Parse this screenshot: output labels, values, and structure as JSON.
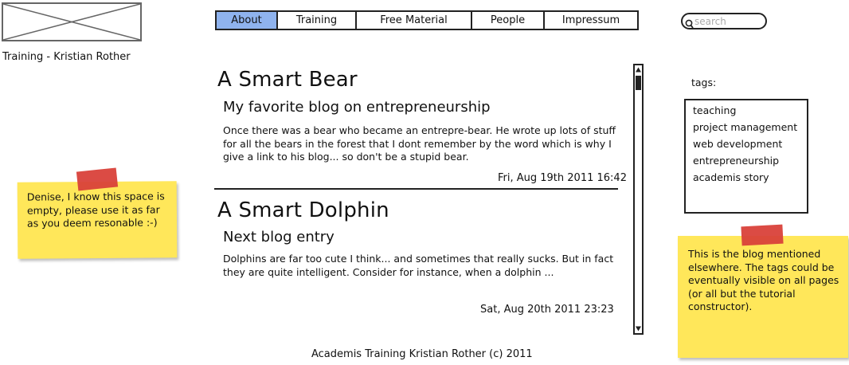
{
  "header": {
    "site_title": "Training - Kristian Rother"
  },
  "nav": {
    "tabs": [
      {
        "label": "About",
        "active": true
      },
      {
        "label": "Training",
        "active": false
      },
      {
        "label": "Free Material",
        "active": false
      },
      {
        "label": "People",
        "active": false
      },
      {
        "label": "Impressum",
        "active": false
      }
    ]
  },
  "search": {
    "placeholder": "search",
    "value": ""
  },
  "posts": [
    {
      "title": "A Smart Bear",
      "subtitle": "My favorite blog on entrepreneurship",
      "body": "Once there was a bear who became an entrepre-bear. He wrote up lots of stuff for all the bears in the forest that I dont remember by the word which is why I give a link to his blog... so don't be a stupid bear.",
      "date": "Fri, Aug 19th 2011 16:42"
    },
    {
      "title": "A Smart Dolphin",
      "subtitle": "Next blog entry",
      "body": "Dolphins are far too cute I think... and sometimes that really sucks. But in fact they are quite intelligent. Consider for instance, when a dolphin ...",
      "date": "Sat, Aug 20th 2011 23:23"
    }
  ],
  "sidebar": {
    "tags_label": "tags:",
    "tags": [
      "teaching",
      "project management",
      "web development",
      "entrepreneurship",
      "academis story"
    ]
  },
  "notes": {
    "left": "Denise, I know this space is empty, please use it as far as you deem resonable :-)",
    "right": "This is the blog mentioned elsewhere. The tags could be eventually visible on all pages (or all but the tutorial constructor)."
  },
  "footer": {
    "text": "Academis Training Kristian Rother (c) 2011"
  },
  "colors": {
    "active_tab": "#8fb3ee",
    "sticky_note": "#ffe75a",
    "tape": "#d9413a",
    "ink": "#222222"
  },
  "icons": {
    "logo": "image-placeholder-icon",
    "search": "search-icon",
    "scroll_up": "arrow-up-icon",
    "scroll_down": "arrow-down-icon"
  }
}
